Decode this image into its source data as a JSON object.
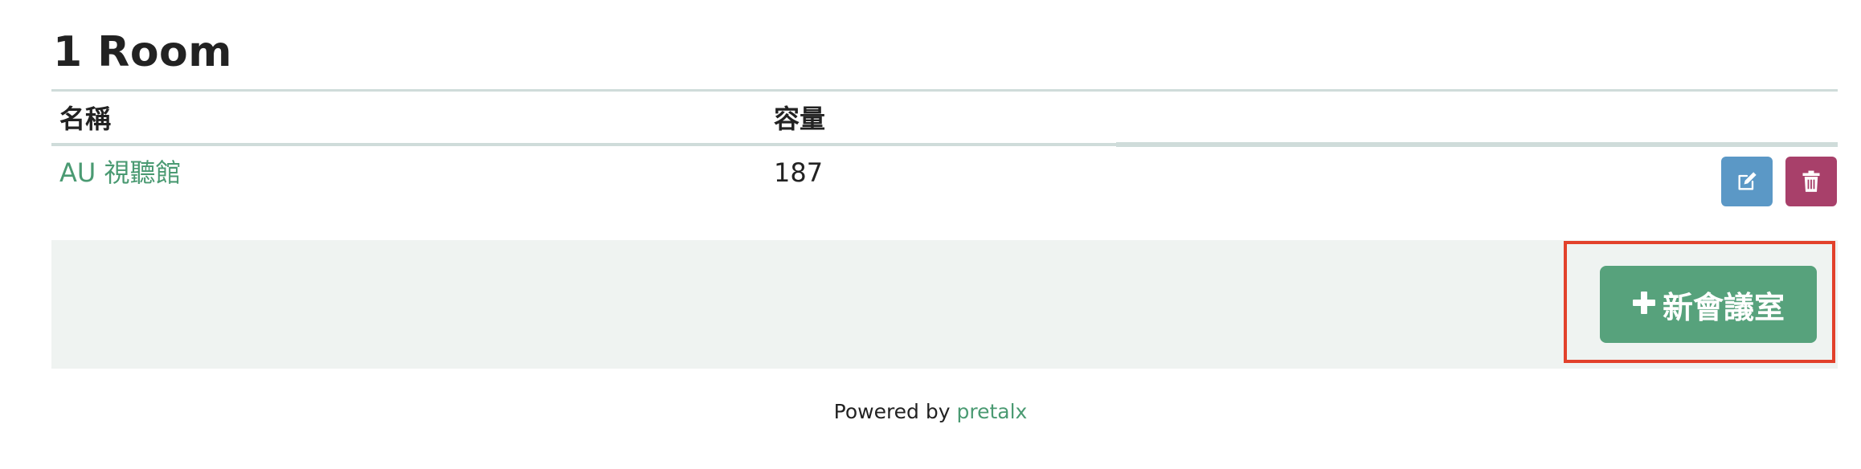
{
  "page": {
    "title": "1 Room"
  },
  "table": {
    "headers": {
      "name": "名稱",
      "capacity": "容量"
    },
    "rows": [
      {
        "name": "AU 視聽館",
        "capacity": "187",
        "actions": [
          "edit-icon",
          "trash-icon"
        ]
      }
    ]
  },
  "actions": {
    "new_room_label": "新會議室",
    "new_room_icon": "plus-icon"
  },
  "footer": {
    "powered_prefix": "Powered by",
    "powered_brand": "pretalx"
  },
  "colors": {
    "accent_green": "#57a27c",
    "link_green": "#4a9a72",
    "edit_blue": "#5b98c6",
    "delete_red": "#a8406a",
    "highlight_red": "#e2412b"
  }
}
